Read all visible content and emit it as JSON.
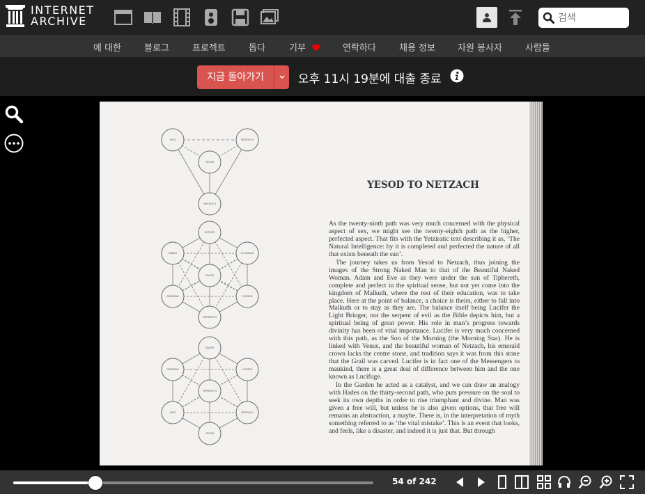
{
  "header": {
    "logo_line1": "INTERNET",
    "logo_line2": "ARCHIVE",
    "media_icons": [
      "web-icon",
      "texts-icon",
      "video-icon",
      "audio-icon",
      "software-icon",
      "images-icon"
    ],
    "search_placeholder": "검색"
  },
  "subnav": {
    "items": [
      "에 대한",
      "블로그",
      "프로젝트",
      "돕다",
      "기부",
      "연락하다",
      "채용 정보",
      "자원 봉사자",
      "사람들"
    ]
  },
  "loan": {
    "return_label": "지금 돌아가기",
    "status_text": "오후 11시 19분에 대출 종료"
  },
  "book": {
    "chapter_title": "YESOD TO NETZACH",
    "paragraphs": [
      "As the twenty-ninth path was very much concerned with the physical aspect of sex, we might see the twenty-eighth path as the higher, perfected aspect. That fits with the Yetziratic text describing it as, ‘The Natural Intelligence: by it is completed and perfected the nature of all that exists beneath the sun’.",
      "The journey takes us from Yesod to Netzach, thus joining the images of the Strong Naked Man to that of the Beautiful Naked Woman. Adam and Eve as they were under the sun of Tiphereth, complete and perfect in the spiritual sense, but not yet come into the kingdom of Malkuth, where the rest of their education, was to take place. Here at the point of balance, a choice is theirs, either to fall into Malkuth or to stay as they are. The balance itself being Lucifer the Light Bringer, not the serpent of evil as the Bible depicts him, but a spiritual being of great power. His role in man’s progress towards divinity has been of vital importance. Lucifer is very much concerned with this path, as the Son of the Morning (the Morning Star). He is linked with Venus, and the beautiful woman of Netzach, his emerald crown lacks the centre stone, and tradition says it was from this stone that the Grail was carved. Lucifer is in fact one of the Messengers to mankind, there is a great deal of difference between him and the one known as Lucifuge.",
      "In the Garden he acted as a catalyst, and we can draw an analogy with Hades on the thirty-second path, who puts pressure on the soul to seek its own depths in order to rise triumphant and divine. Man was given a free will, but unless he is also given options, that free will remains an abstraction, a maybe. There is, in the interpretation of myth something referred to as ‘the vital mistake’. This is an event that looks, and feels, like a disaster, and indeed it is just that. But through"
    ],
    "diagram_labels": {
      "d1": [
        "HOD",
        "NETZACH",
        "YESOD",
        "MALKUTH"
      ],
      "d2": [
        "KETHER",
        "BINAH",
        "CHOKMAH",
        "DAATH",
        "GEBURAH",
        "CHESED",
        "TIPHERETH"
      ],
      "d3": [
        "DAATH",
        "GEBURAH",
        "CHESED",
        "TIPHERETH",
        "HOD",
        "NETZACH",
        "YESOD"
      ]
    }
  },
  "toolbar": {
    "page_indicator": "54 of 242",
    "progress": 0.228,
    "icons": [
      "prev-page-icon",
      "next-page-icon",
      "one-page-view-icon",
      "two-page-view-icon",
      "thumbnail-view-icon",
      "read-aloud-icon",
      "zoom-out-icon",
      "zoom-in-icon",
      "fullscreen-icon"
    ]
  }
}
